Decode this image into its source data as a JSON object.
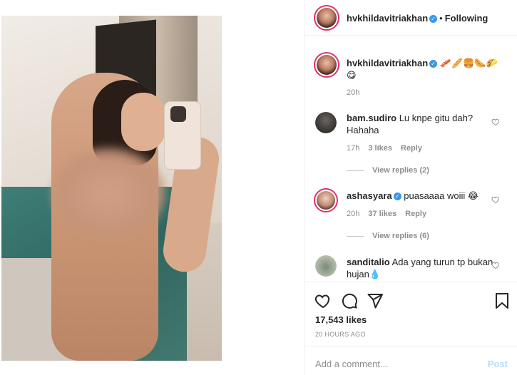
{
  "post": {
    "author": "hvkhildavitriakhan",
    "follow_label": "Following",
    "separator": "•",
    "caption_emojis": "🥓🥖🍔🌭🌮",
    "caption_emoji_2": "😋",
    "caption_time": "20h"
  },
  "comments": [
    {
      "user": "bam.sudiro",
      "text": "Lu knpe gitu dah? Hahaha",
      "time": "17h",
      "likes": "3 likes",
      "reply_label": "Reply",
      "view_replies": "View replies (2)"
    },
    {
      "user": "ashasyara",
      "text": "puasaaaa woiii 😂",
      "time": "20h",
      "likes": "37 likes",
      "reply_label": "Reply",
      "view_replies": "View replies (6)",
      "verified": true
    },
    {
      "user": "sanditalio",
      "text": "Ada yang turun tp bukan hujan💧"
    }
  ],
  "stats": {
    "likes": "17,543 likes",
    "timestamp": "20 HOURS AGO"
  },
  "add_comment": {
    "placeholder": "Add a comment...",
    "post_label": "Post"
  },
  "colors": {
    "verified": "#3897f0",
    "post_disabled": "#b2dffc",
    "story_ring": "#e1306c"
  }
}
